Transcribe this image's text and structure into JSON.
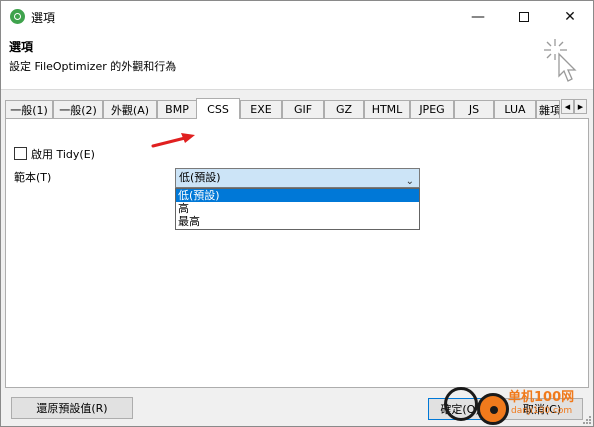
{
  "window": {
    "title": "選項",
    "minimize_glyph": "—",
    "close_glyph": "✕"
  },
  "header": {
    "title": "選項",
    "subtitle": "設定 FileOptimizer 的外觀和行為"
  },
  "tabs": [
    {
      "label": "一般(1)"
    },
    {
      "label": "一般(2)"
    },
    {
      "label": "外觀(A)"
    },
    {
      "label": "BMP"
    },
    {
      "label": "CSS",
      "active": true
    },
    {
      "label": "EXE"
    },
    {
      "label": "GIF"
    },
    {
      "label": "GZ"
    },
    {
      "label": "HTML"
    },
    {
      "label": "JPEG"
    },
    {
      "label": "JS"
    },
    {
      "label": "LUA"
    },
    {
      "label": "雜項"
    }
  ],
  "tab_scroll": {
    "left": "◀",
    "right": "▶"
  },
  "css_panel": {
    "tidy_checkbox": {
      "label": "啟用 Tidy(E)",
      "checked": false
    },
    "template_label": "範本(T)",
    "template_select": {
      "value": "低(預設)",
      "arrow": "⌄",
      "options": [
        "低(預設)",
        "高",
        "最高"
      ],
      "highlighted_index": 0
    }
  },
  "buttons": {
    "restore": "還原預設值(R)",
    "ok": "確定(O)",
    "cancel": "取消(C)"
  },
  "watermark": {
    "text": "单机100网",
    "url": "danji100.com"
  },
  "colors": {
    "accent": "#0078d7",
    "annotation_arrow": "#e02020",
    "watermark": "#f07a1c"
  }
}
